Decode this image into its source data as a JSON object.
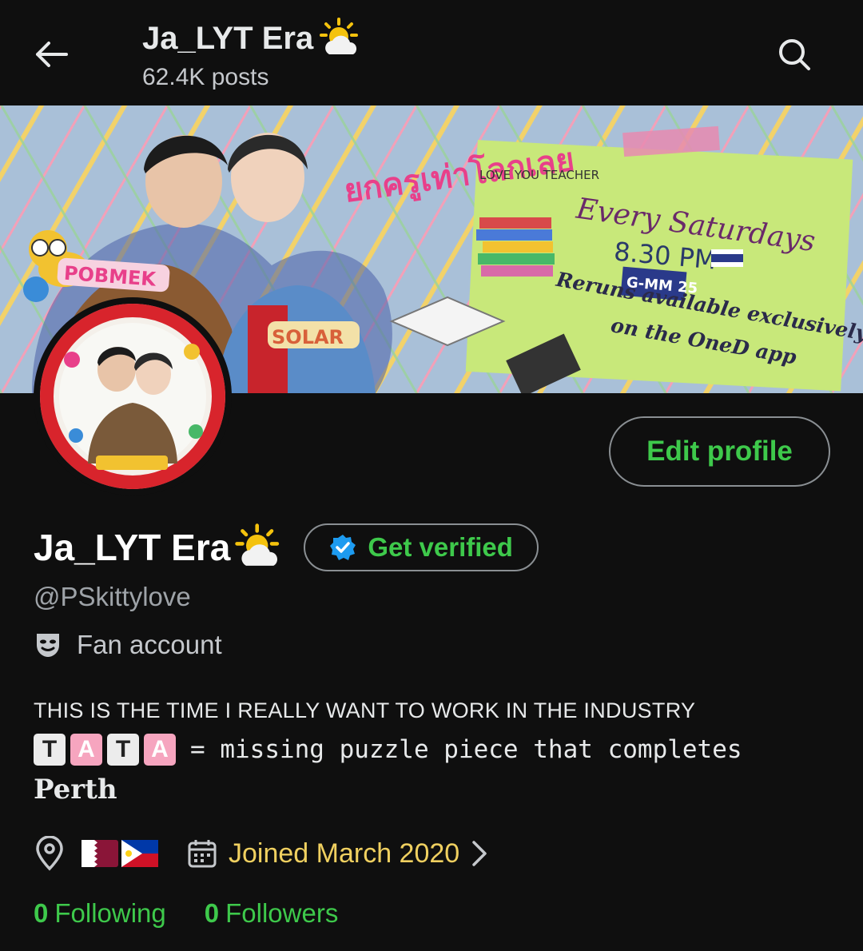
{
  "header": {
    "title": "Ja_LYT Era",
    "post_count": "62.4K posts"
  },
  "banner": {
    "show_title_thai": "ยกครูเท่าโลกเลย",
    "show_title_en": "LOVE YOU TEACHER",
    "schedule": "Every Saturdays",
    "time": "8.30 PM",
    "channel": "G-MM 25",
    "reruns": "Reruns available exclusively",
    "reruns2": "on the OneD app",
    "tag_left": "POBMEK",
    "tag_right": "SOLAR"
  },
  "profile": {
    "edit_label": "Edit profile",
    "display_name": "Ja_LYT Era",
    "verified_label": "Get verified",
    "handle": "@PSkittylove",
    "category": "Fan account",
    "bio_line1": "THIS IS THE TIME I REALLY WANT TO WORK IN THE INDUSTRY",
    "bio_tata": [
      "T",
      "A",
      "T",
      "A"
    ],
    "bio_line2": "= missing puzzle piece that completes",
    "bio_line3": "Perth",
    "joined": "Joined March 2020",
    "following_count": "0",
    "following_label": "Following",
    "followers_count": "0",
    "followers_label": "Followers"
  },
  "icons": {
    "back": "arrow-left-icon",
    "search": "search-icon",
    "verified": "verified-badge-icon",
    "category": "mask-icon",
    "location": "location-pin-icon",
    "calendar": "calendar-icon",
    "chevron": "chevron-right-icon"
  },
  "colors": {
    "accent_green": "#3ec94b",
    "joined_yellow": "#f0d060",
    "background": "#0f0f0f",
    "verified_blue": "#1d9bf0"
  }
}
